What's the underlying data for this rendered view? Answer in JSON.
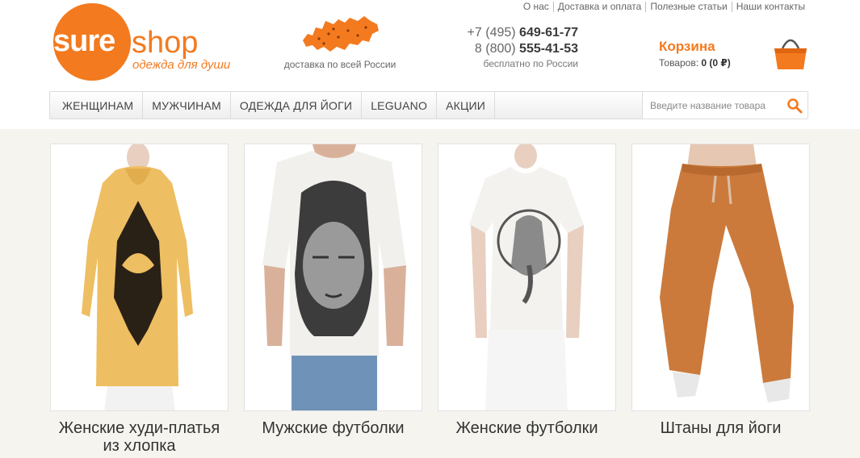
{
  "header": {
    "top_links": [
      "О нас",
      "Доставка и оплата",
      "Полезные статьи",
      "Наши контакты"
    ],
    "logo": {
      "word1": "sure",
      "word2": "shop",
      "tagline": "одежда для души"
    },
    "delivery_caption": "доставка по всей России",
    "phones": [
      {
        "prefix": "+7 (495)",
        "number": "649-61-77"
      },
      {
        "prefix": "8 (800)",
        "number": "555-41-53"
      }
    ],
    "phones_note": "бесплатно по России",
    "cart": {
      "title": "Корзина",
      "items_label": "Товаров:",
      "summary": "0 (0 ₽)"
    }
  },
  "nav": {
    "items": [
      "ЖЕНЩИНАМ",
      "МУЖЧИНАМ",
      "ОДЕЖДА ДЛЯ ЙОГИ",
      "LEGUANO",
      "АКЦИИ"
    ],
    "search_placeholder": "Введите название товара"
  },
  "products": [
    {
      "title_line1": "Женские худи-платья",
      "title_line2": "из хлопка"
    },
    {
      "title_line1": "Мужские футболки",
      "title_line2": ""
    },
    {
      "title_line1": "Женские футболки",
      "title_line2": ""
    },
    {
      "title_line1": "Штаны для йоги",
      "title_line2": ""
    }
  ],
  "colors": {
    "brand_orange": "#f37a1f",
    "page_bg": "#f5f4ef",
    "text_dark": "#333333"
  }
}
